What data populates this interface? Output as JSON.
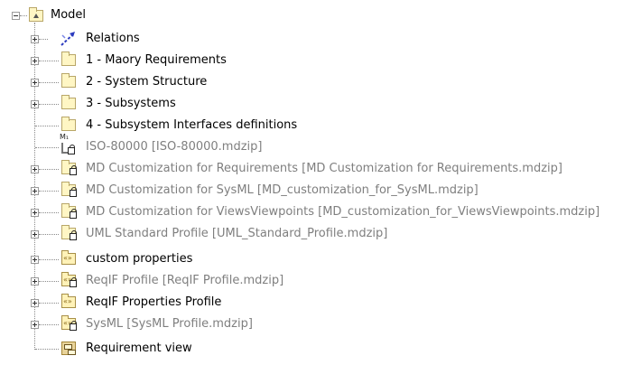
{
  "tree": {
    "root": {
      "label": "Model",
      "icon": "model-package-icon",
      "expanded": true
    },
    "items": [
      {
        "label": "Relations",
        "icon": "relations-icon",
        "expandable": true,
        "gray": false
      },
      {
        "label": "1 - Maory Requirements",
        "icon": "folder-icon",
        "expandable": true,
        "gray": false
      },
      {
        "label": "2 - System Structure",
        "icon": "folder-icon",
        "expandable": true,
        "gray": false
      },
      {
        "label": "3 - Subsystems",
        "icon": "folder-icon",
        "expandable": true,
        "gray": false
      },
      {
        "label": "4 - Subsystem Interfaces definitions",
        "icon": "folder-icon",
        "expandable": false,
        "gray": false
      },
      {
        "label": "ISO-80000 [ISO-80000.mdzip]",
        "icon": "measurement-library-icon",
        "expandable": false,
        "gray": true
      },
      {
        "label": "MD Customization for Requirements [MD Customization for Requirements.mdzip]",
        "icon": "locked-folder-icon",
        "expandable": true,
        "gray": true
      },
      {
        "label": "MD Customization for SysML [MD_customization_for_SysML.mdzip]",
        "icon": "locked-folder-icon",
        "expandable": true,
        "gray": true
      },
      {
        "label": "MD Customization for ViewsViewpoints [MD_customization_for_ViewsViewpoints.mdzip]",
        "icon": "locked-folder-icon",
        "expandable": true,
        "gray": true
      },
      {
        "label": "UML Standard Profile [UML_Standard_Profile.mdzip]",
        "icon": "locked-folder-icon",
        "expandable": true,
        "gray": true
      },
      {
        "label": "custom properties",
        "icon": "profile-icon",
        "expandable": true,
        "gray": false
      },
      {
        "label": "ReqIF Profile [ReqIF Profile.mdzip]",
        "icon": "locked-profile-icon",
        "expandable": true,
        "gray": true
      },
      {
        "label": "ReqIF Properties Profile",
        "icon": "profile-icon",
        "expandable": true,
        "gray": false
      },
      {
        "label": "SysML [SysML Profile.mdzip]",
        "icon": "locked-profile-icon",
        "expandable": true,
        "gray": true
      },
      {
        "label": "Requirement view",
        "icon": "view-icon",
        "expandable": false,
        "gray": false
      }
    ]
  },
  "colors": {
    "text": "#000000",
    "gray_text": "#7f7f7f",
    "folder_fill": "#fff6c4",
    "folder_border": "#b8a668"
  }
}
